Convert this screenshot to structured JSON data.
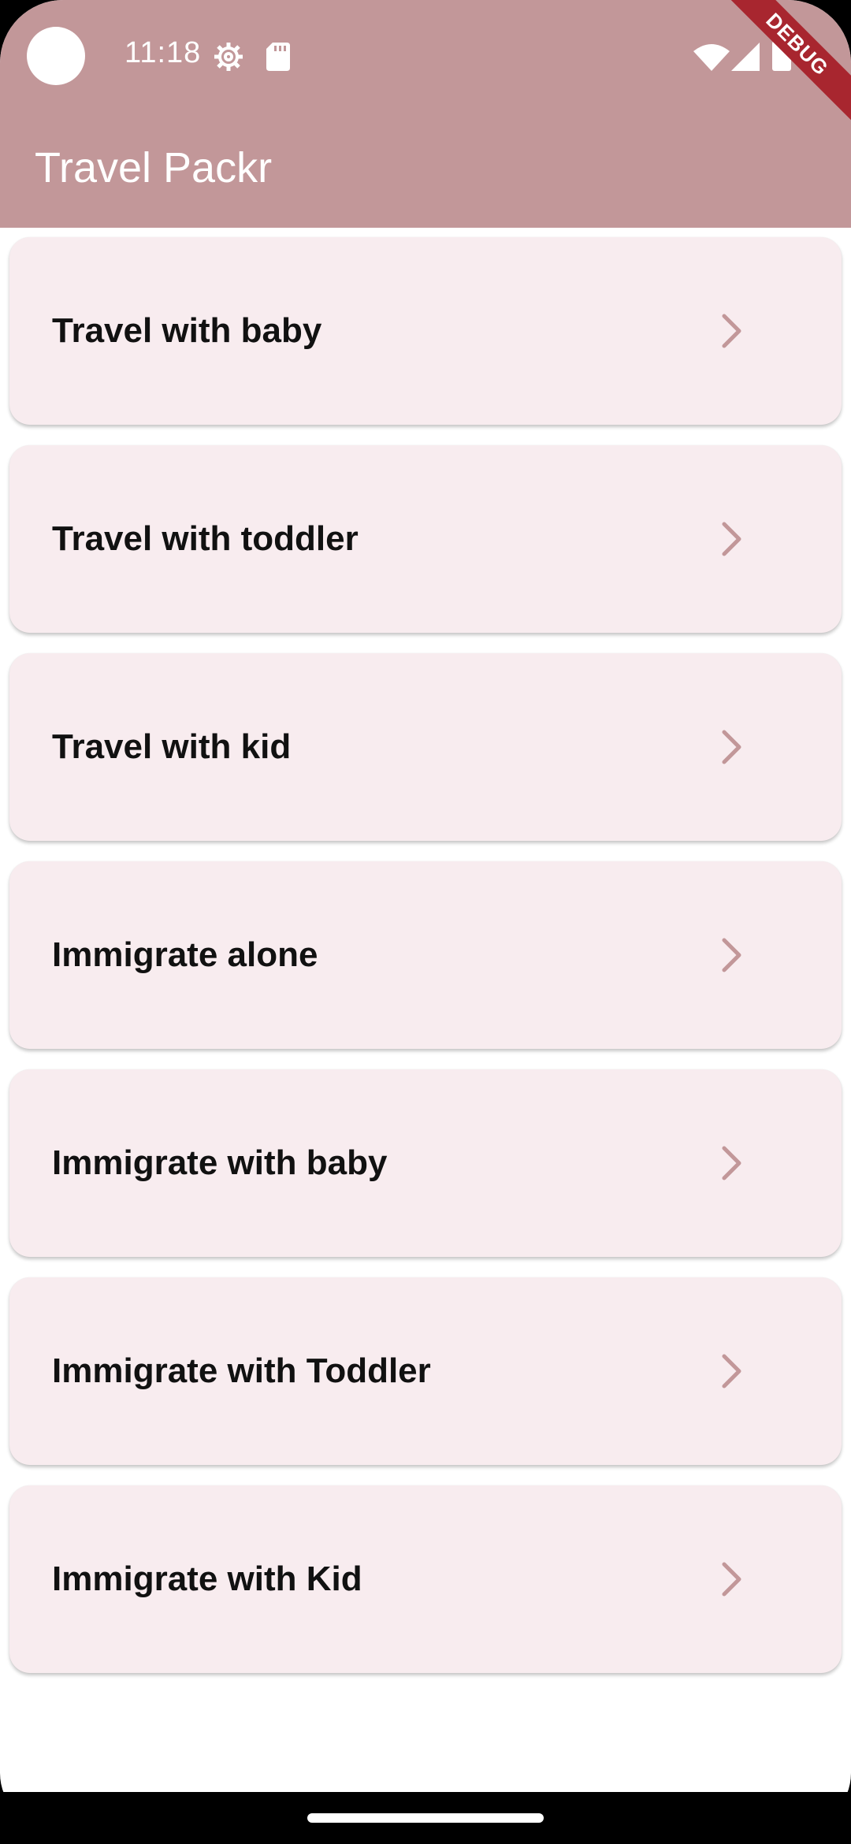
{
  "status_bar": {
    "time": "11:18",
    "icons": [
      "camera-cutout",
      "gear-icon",
      "sd-card-icon",
      "wifi-icon",
      "cell-signal-icon",
      "battery-icon"
    ]
  },
  "debug_banner": {
    "label": "DEBUG"
  },
  "app_bar": {
    "title": "Travel Packr"
  },
  "list": {
    "items": [
      {
        "label": "Travel with baby"
      },
      {
        "label": "Travel with toddler"
      },
      {
        "label": "Travel with kid"
      },
      {
        "label": "Immigrate alone"
      },
      {
        "label": "Immigrate with baby"
      },
      {
        "label": "Immigrate with Toddler"
      },
      {
        "label": "Immigrate with Kid"
      }
    ],
    "chevron_icon": "chevron-right-icon"
  },
  "colors": {
    "app_bar": "#c29799",
    "card_background": "#f8ecef",
    "chevron": "#c29799",
    "debug_ribbon": "#a8262f",
    "text": "#111111"
  }
}
